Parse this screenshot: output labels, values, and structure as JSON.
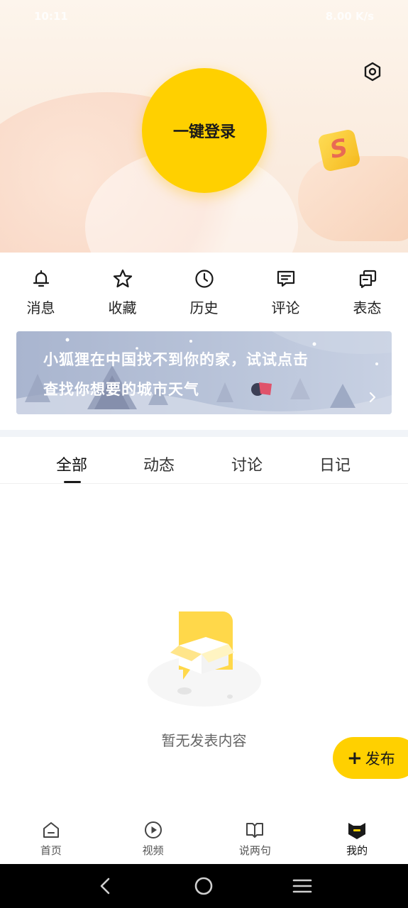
{
  "status_bar": {
    "time": "10:11",
    "right": "8.00 K/s"
  },
  "header": {
    "login_label": "一键登录"
  },
  "quick_menu": [
    {
      "label": "消息",
      "icon": "bell-icon"
    },
    {
      "label": "收藏",
      "icon": "star-icon"
    },
    {
      "label": "历史",
      "icon": "clock-icon"
    },
    {
      "label": "评论",
      "icon": "comment-icon"
    },
    {
      "label": "表态",
      "icon": "stack-icon"
    }
  ],
  "banner": {
    "line1": "小狐狸在中国找不到你的家，试试点击",
    "line2": "查找你想要的城市天气"
  },
  "tabs": [
    {
      "label": "全部",
      "active": true
    },
    {
      "label": "动态",
      "active": false
    },
    {
      "label": "讨论",
      "active": false
    },
    {
      "label": "日记",
      "active": false
    }
  ],
  "empty": {
    "text": "暂无发表内容"
  },
  "publish_label": "发布",
  "bottom_nav": [
    {
      "label": "首页",
      "icon": "home-icon",
      "active": false
    },
    {
      "label": "视频",
      "icon": "play-icon",
      "active": false
    },
    {
      "label": "说两句",
      "icon": "book-icon",
      "active": false
    },
    {
      "label": "我的",
      "icon": "fox-icon",
      "active": true
    }
  ],
  "colors": {
    "accent": "#ffd000",
    "text": "#222222",
    "banner": "#b4bfd6"
  }
}
